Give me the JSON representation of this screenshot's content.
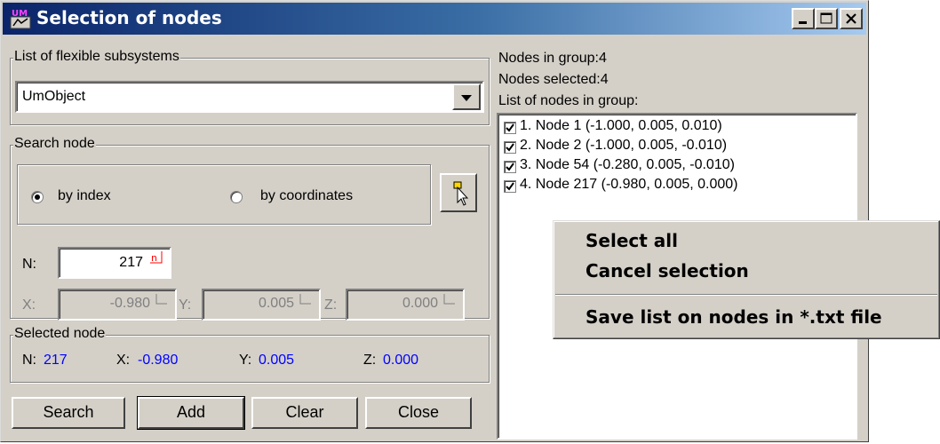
{
  "window": {
    "title": "Selection of nodes",
    "controls": {
      "minimize": "minimize",
      "maximize": "maximize",
      "close": "close"
    }
  },
  "subsystems": {
    "group_label": "List of flexible subsystems",
    "selected": "UmObject"
  },
  "search": {
    "group_label": "Search node",
    "by_index_label": "by index",
    "by_coordinates_label": "by coordinates",
    "mode": "by index",
    "n_label": "N:",
    "n_value": "217",
    "x_label": "X:",
    "x_value": "-0.980",
    "y_label": "Y:",
    "y_value": "0.005",
    "z_label": "Z:",
    "z_value": "0.000"
  },
  "selected_node": {
    "group_label": "Selected node",
    "n_label": "N:",
    "n_value": "217",
    "x_label": "X:",
    "x_value": "-0.980",
    "y_label": "Y:",
    "y_value": "0.005",
    "z_label": "Z:",
    "z_value": "0.000"
  },
  "buttons": {
    "search": "Search",
    "add": "Add",
    "clear": "Clear",
    "close": "Close"
  },
  "group_info": {
    "nodes_in_group": "Nodes in group:4",
    "nodes_selected": "Nodes selected:4",
    "list_label": "List of nodes in group:"
  },
  "nodes": [
    {
      "label": "1. Node 1 (-1.000,  0.005,  0.010)",
      "checked": true
    },
    {
      "label": "2. Node 2 (-1.000,  0.005, -0.010)",
      "checked": true
    },
    {
      "label": "3. Node 54 (-0.280,  0.005, -0.010)",
      "checked": true
    },
    {
      "label": "4. Node 217 (-0.980,  0.005,  0.000)",
      "checked": true
    }
  ],
  "context_menu": {
    "select_all": "Select all",
    "cancel_selection": "Cancel selection",
    "save_list": "Save list on nodes in *.txt file"
  },
  "colors": {
    "face": "#d4d0c8",
    "title_start": "#0a246a",
    "title_end": "#a6caf0",
    "value_blue": "#0000ff"
  }
}
